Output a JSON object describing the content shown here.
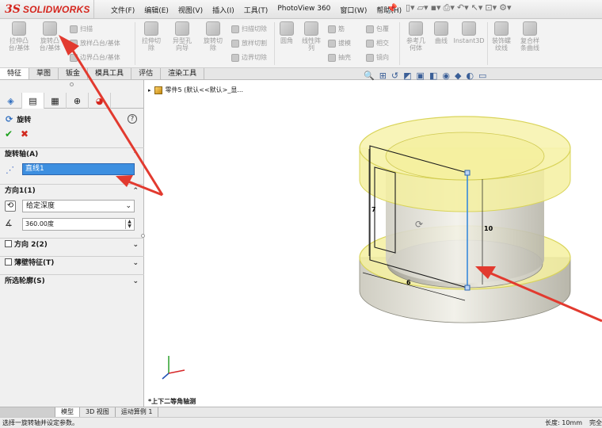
{
  "app": {
    "logo_mark": "3S",
    "name": "SOLIDWORKS"
  },
  "menu": [
    "文件(F)",
    "编辑(E)",
    "视图(V)",
    "插入(I)",
    "工具(T)",
    "PhotoView 360",
    "窗口(W)",
    "帮助(H)"
  ],
  "quick_icons": [
    "new-icon",
    "open-icon",
    "save-icon",
    "print-icon",
    "undo-icon",
    "select-icon",
    "rebuild-icon",
    "options-icon"
  ],
  "ribbon": {
    "extrude_boss": "拉伸凸\n台/基体",
    "revolve_boss": "旋转凸\n台/基体",
    "sweep": "扫描",
    "loft_boss": "放样凸台/基体",
    "boundary_boss": "边界凸台/基体",
    "extrude_cut": "拉伸切\n除",
    "hole_wizard": "异型孔\n向导",
    "revolve_cut": "旋转切\n除",
    "sweep_cut": "扫描切除",
    "loft_cut": "放样切割",
    "boundary_cut": "边界切除",
    "fillet": "圆角",
    "linear_pattern": "线性阵\n列",
    "rib": "筋",
    "draft": "拔模",
    "shell": "抽壳",
    "wrap": "包覆",
    "intersect": "相交",
    "mirror": "镜向",
    "ref_geometry": "参考几\n何体",
    "curves": "曲线",
    "instant3d": "Instant3D",
    "helix": "装饰螺\n纹线",
    "combine": "复合样\n条曲线"
  },
  "command_tabs": [
    "特征",
    "草图",
    "钣金",
    "模具工具",
    "评估",
    "渲染工具"
  ],
  "active_command_tab": "特征",
  "manager_tabs": [
    "feature-manager-icon",
    "property-manager-icon",
    "configuration-manager-icon",
    "dimxpert-icon",
    "display-manager-icon"
  ],
  "property_manager": {
    "title": "旋转",
    "axis_group": "旋转轴(A)",
    "axis_value": "直线1",
    "direction1_group": "方向1(1)",
    "end_condition": "给定深度",
    "angle_value": "360.00度",
    "direction2_label": "方向 2(2)",
    "thin_feature_label": "薄壁特征(T)",
    "selected_contours_label": "所选轮廓(S)"
  },
  "viewport": {
    "tree_label": "零件5 (默认<<默认>_显...",
    "view_name": "*上下二等角轴测",
    "dimensions": {
      "sketch_height": "7",
      "profile_width": "6",
      "axis_length": "10"
    }
  },
  "bottom_tabs": [
    "模型",
    "3D 视图",
    "运动算例 1"
  ],
  "active_bottom_tab": "模型",
  "status": {
    "message": "选择一旋转轴并设定参数。",
    "length": "长度: 10mm",
    "state": "完全"
  },
  "colors": {
    "logo_red": "#d5261e",
    "part_yellow": "#f5f0a0",
    "arrow_red": "#e23a2f",
    "axis_blue": "#3d8fe0"
  }
}
